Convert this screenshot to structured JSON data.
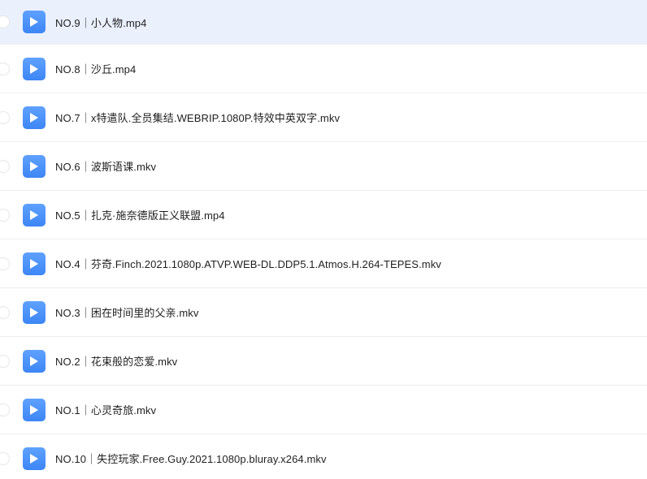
{
  "files": [
    {
      "name": "NO.9｜小人物.mp4",
      "selected": true
    },
    {
      "name": "NO.8｜沙丘.mp4",
      "selected": false
    },
    {
      "name": "NO.7｜x特遣队.全员集结.WEBRIP.1080P.特效中英双字.mkv",
      "selected": false
    },
    {
      "name": "NO.6｜波斯语课.mkv",
      "selected": false
    },
    {
      "name": "NO.5｜扎克·施奈德版正义联盟.mp4",
      "selected": false
    },
    {
      "name": "NO.4｜芬奇.Finch.2021.1080p.ATVP.WEB-DL.DDP5.1.Atmos.H.264-TEPES.mkv",
      "selected": false
    },
    {
      "name": "NO.3｜困在时间里的父亲.mkv",
      "selected": false
    },
    {
      "name": "NO.2｜花束般的恋爱.mkv",
      "selected": false
    },
    {
      "name": "NO.1｜心灵奇旅.mkv",
      "selected": false
    },
    {
      "name": "NO.10｜失控玩家.Free.Guy.2021.1080p.bluray.x264.mkv",
      "selected": false
    }
  ],
  "icon": "video-play-icon",
  "colors": {
    "selected_row": "#eaf1fd",
    "icon_top": "#5fa1ff",
    "icon_bottom": "#3d86f5",
    "divider": "#eeeeee"
  }
}
